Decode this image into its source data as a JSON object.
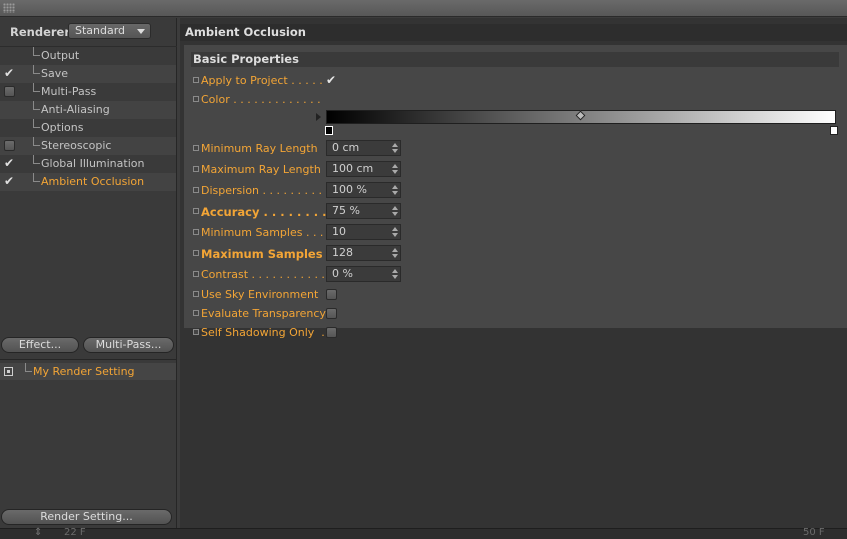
{
  "renderer": {
    "label": "Renderer",
    "selected": "Standard"
  },
  "tree": [
    {
      "label": "Output",
      "check": "none"
    },
    {
      "label": "Save",
      "check": "tick"
    },
    {
      "label": "Multi-Pass",
      "check": "box"
    },
    {
      "label": "Anti-Aliasing",
      "check": "none"
    },
    {
      "label": "Options",
      "check": "none"
    },
    {
      "label": "Stereoscopic",
      "check": "box"
    },
    {
      "label": "Global Illumination",
      "check": "tick"
    },
    {
      "label": "Ambient Occlusion",
      "check": "tick",
      "active": true
    }
  ],
  "buttons": {
    "effect": "Effect...",
    "multipass": "Multi-Pass...",
    "render_setting": "Render Setting..."
  },
  "render_settings": {
    "item": "My Render Setting"
  },
  "panel": {
    "title": "Ambient Occlusion",
    "group": "Basic Properties",
    "apply_to_project": "Apply to Project . . . . .",
    "apply_to_project_checked": true,
    "color": "Color . . . . . . . . . . . . .",
    "min_ray_label": "Minimum Ray Length",
    "min_ray_value": "0 cm",
    "max_ray_label": "Maximum Ray Length",
    "max_ray_value": "100 cm",
    "dispersion_label": "Dispersion . . . . . . . . . .",
    "dispersion_value": "100 %",
    "accuracy_label": "Accuracy . . . . . . . . . .",
    "accuracy_value": "75 %",
    "min_samples_label": "Minimum Samples . . .",
    "min_samples_value": "10",
    "max_samples_label": "Maximum Samples",
    "max_samples_value": "128",
    "contrast_label": "Contrast . . . . . . . . . . .",
    "contrast_value": "0 %",
    "sky_label": "Use Sky Environment",
    "transparency_label": "Evaluate Transparency",
    "self_shadow_label": "Self Shadowing Only  ."
  },
  "timeline": {
    "start_frame": "22 F",
    "end_frame": "50 F"
  },
  "colors": {
    "accent": "#f3a536",
    "panel_bg": "#474747"
  }
}
